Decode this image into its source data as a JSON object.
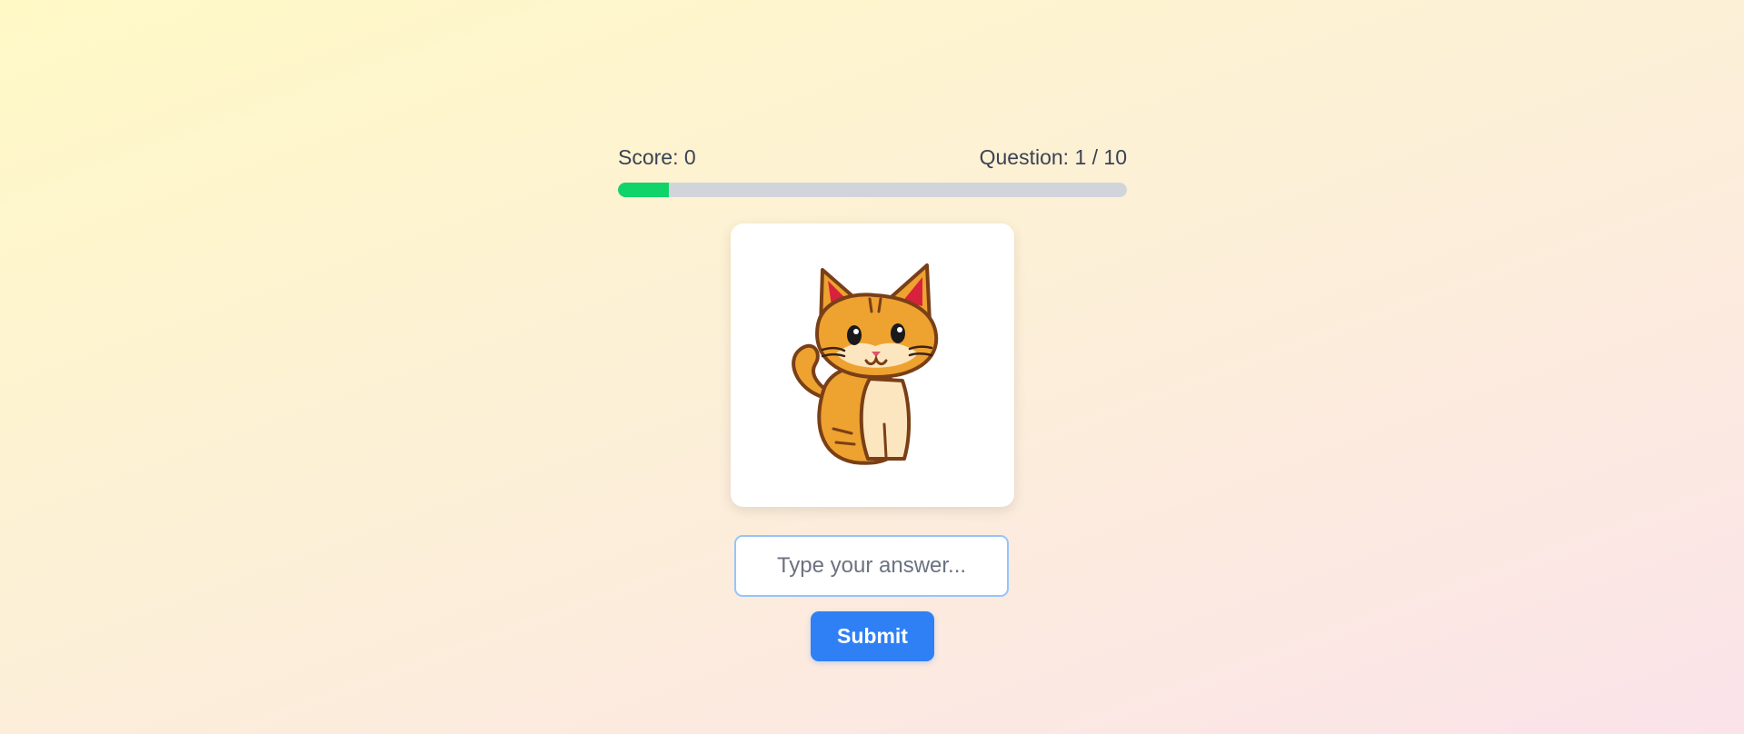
{
  "quiz": {
    "score_text": "Score: 0",
    "question_text": "Question: 1 / 10",
    "progress_fraction": 0.1,
    "image_icon": "cat-icon",
    "answer": {
      "value": "",
      "placeholder": "Type your answer..."
    },
    "submit_label": "Submit"
  },
  "colors": {
    "progress_fill": "#10d46a",
    "progress_track": "#d1d5db",
    "submit_button": "#2f80f5",
    "input_border": "#93c5fd"
  }
}
